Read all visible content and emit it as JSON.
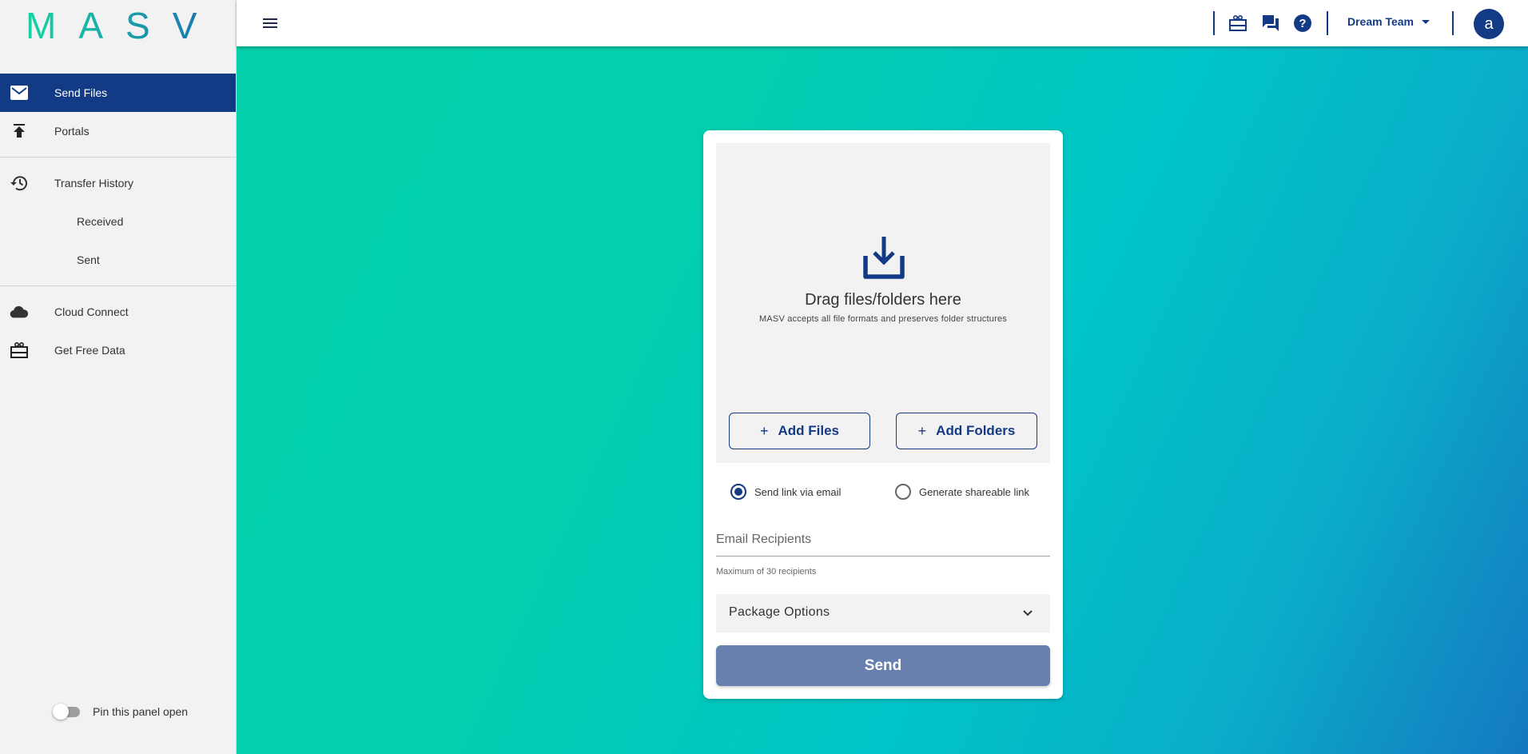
{
  "brand": {
    "logo_letters": [
      "M",
      "A",
      "S",
      "V"
    ],
    "colors": {
      "primary": "#133a84",
      "logo_start": "#17d4a5",
      "logo_end": "#1b6fb0",
      "send_disabled": "#6880b0"
    }
  },
  "sidebar": {
    "items": [
      {
        "label": "Send Files",
        "icon": "mail-icon",
        "active": true
      },
      {
        "label": "Portals",
        "icon": "upload-icon"
      },
      {
        "label": "Transfer History",
        "icon": "history-icon"
      },
      {
        "label": "Received",
        "sub": true
      },
      {
        "label": "Sent",
        "sub": true
      },
      {
        "label": "Cloud Connect",
        "icon": "cloud-icon"
      },
      {
        "label": "Get Free Data",
        "icon": "gift-icon"
      }
    ],
    "pin_label": "Pin this panel open",
    "pin_enabled": false
  },
  "topbar": {
    "menu_icon": "hamburger-icon",
    "icons": [
      "gift-icon",
      "chat-icon",
      "help-icon"
    ],
    "team_name": "Dream Team",
    "avatar_letter": "a"
  },
  "upload": {
    "drop_title": "Drag files/folders here",
    "drop_subtitle": "MASV accepts all file formats and preserves folder structures",
    "add_files_plus": "+",
    "add_files_label": "Add Files",
    "add_folders_plus": "+",
    "add_folders_label": "Add Folders",
    "delivery_options": [
      {
        "label": "Send link via email",
        "selected": true
      },
      {
        "label": "Generate shareable link",
        "selected": false
      }
    ],
    "email_placeholder": "Email Recipients",
    "email_value": "",
    "email_hint": "Maximum of 30 recipients",
    "package_options_label": "Package Options",
    "send_label": "Send"
  }
}
